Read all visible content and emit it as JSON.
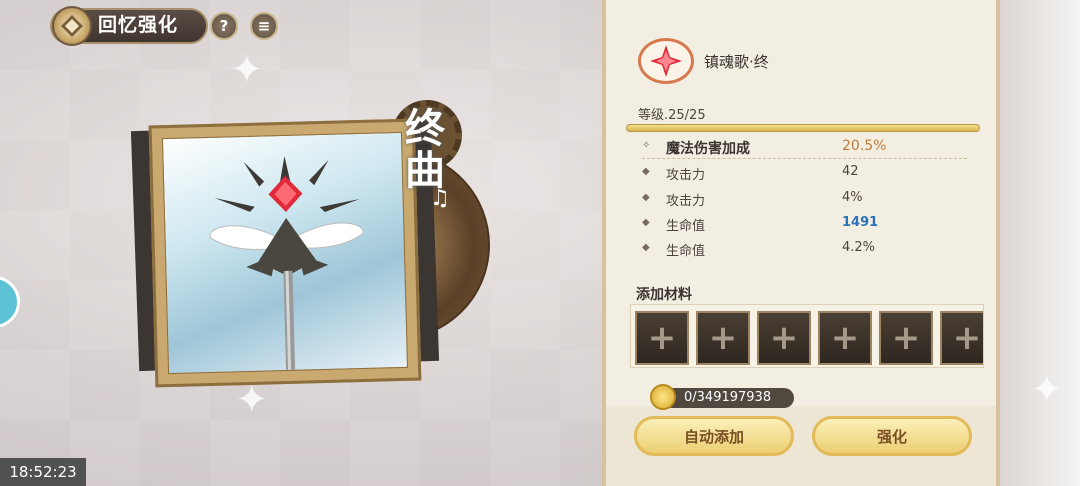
{
  "header": {
    "title": "回忆强化",
    "help_label": "?",
    "info_label": "≡"
  },
  "card": {
    "title_chars": [
      "终",
      "曲"
    ],
    "note_glyph": "♫"
  },
  "item": {
    "name": "镇魂歌·终",
    "level": "等级.25/25",
    "level_progress": 1.0
  },
  "stats": [
    {
      "label": "魔法伤害加成",
      "value": "20.5%",
      "primary": true
    },
    {
      "label": "攻击力",
      "value": "42"
    },
    {
      "label": "攻击力",
      "value": "4%"
    },
    {
      "label": "生命值",
      "value": "1491",
      "value_color": "#2a73b8"
    },
    {
      "label": "生命值",
      "value": "4.2%"
    }
  ],
  "materials": {
    "title": "添加材料",
    "slot_glyph": "+",
    "slot_count": 6
  },
  "gold": {
    "text": "0/349197938"
  },
  "buttons": {
    "auto_add": "自动添加",
    "enhance": "强化"
  },
  "clock": "18:52:23",
  "colors": {
    "accent": "#eccf73",
    "primary_stat": "#c57b3b",
    "highlight_value": "#2a73b8"
  }
}
